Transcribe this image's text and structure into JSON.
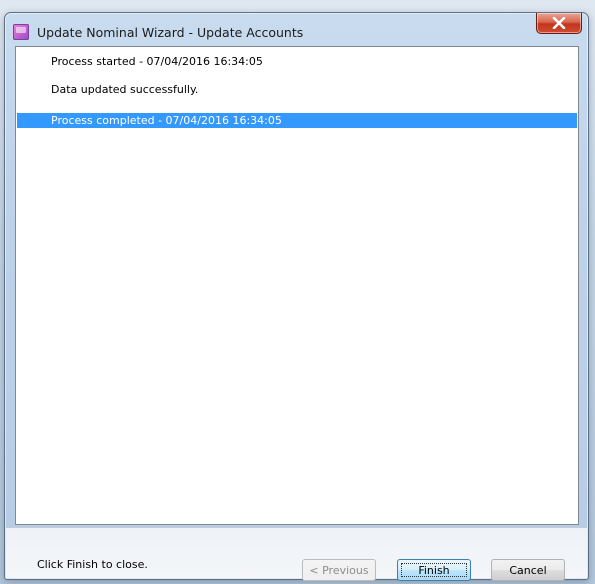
{
  "window": {
    "title": "Update Nominal Wizard - Update Accounts",
    "app_icon": "wizard-app-icon",
    "close_icon": "close-x-icon"
  },
  "log": {
    "lines": [
      "Process started - 07/04/2016 16:34:05",
      "Data updated successfully.",
      "Process completed - 07/04/2016 16:34:05"
    ],
    "selected_index": 2,
    "selection_color": "#3399ff"
  },
  "footer": {
    "instruction": "Click Finish to close.",
    "buttons": {
      "previous": "< Previous",
      "finish": "Finish",
      "cancel": "Cancel"
    }
  },
  "colors": {
    "close_button": "#c1361c",
    "default_button_border": "#3c7fb1"
  }
}
